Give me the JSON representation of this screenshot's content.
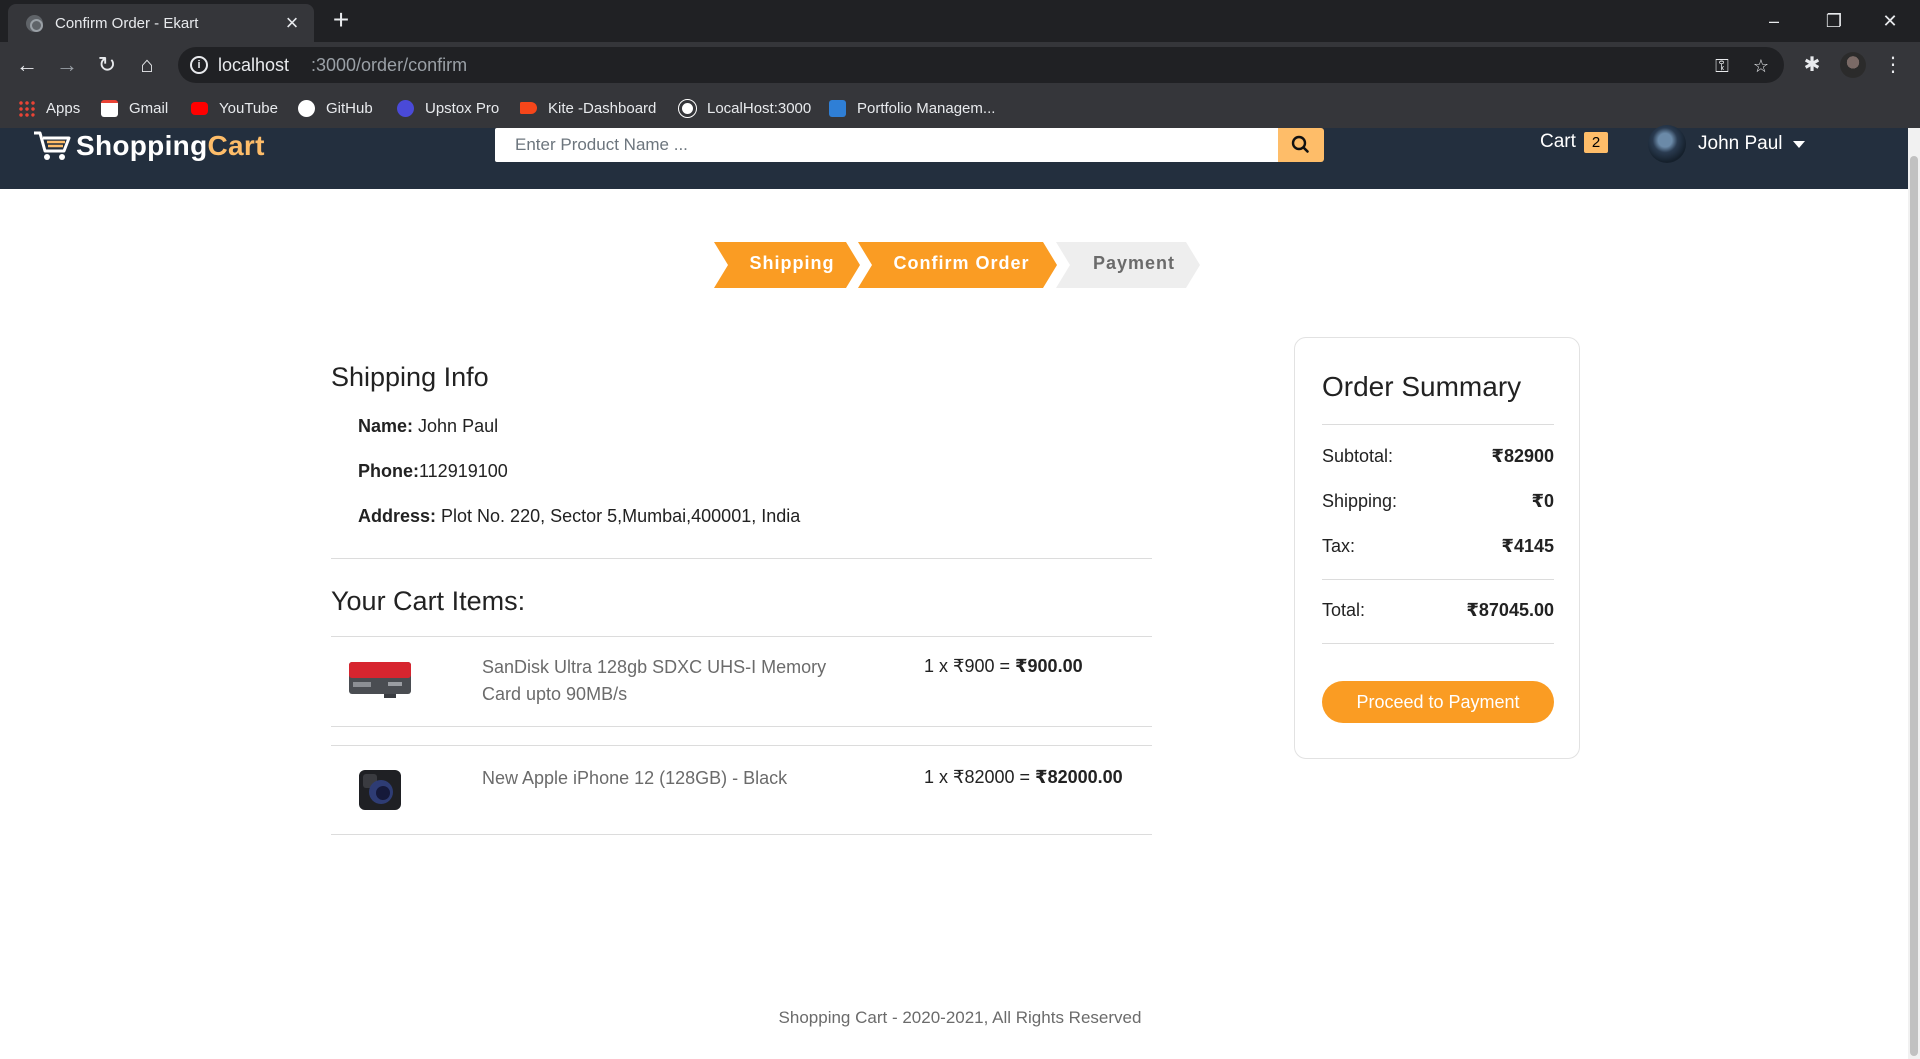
{
  "browser": {
    "tab_title": "Confirm Order - Ekart",
    "url_host": "localhost",
    "url_path": ":3000/order/confirm",
    "bookmarks": [
      {
        "label": "Apps",
        "icon": "apps-grid-icon"
      },
      {
        "label": "Gmail",
        "icon": "gmail-icon"
      },
      {
        "label": "YouTube",
        "icon": "youtube-icon"
      },
      {
        "label": "GitHub",
        "icon": "github-icon"
      },
      {
        "label": "Upstox Pro",
        "icon": "upstox-icon"
      },
      {
        "label": "Kite -Dashboard",
        "icon": "kite-icon"
      },
      {
        "label": "LocalHost:3000",
        "icon": "globe-icon"
      },
      {
        "label": "Portfolio Managem...",
        "icon": "portfolio-icon"
      }
    ]
  },
  "header": {
    "logo_main": "Shopping",
    "logo_accent": "Cart",
    "search_placeholder": "Enter Product Name ...",
    "cart_label": "Cart",
    "cart_count": "2",
    "user_name": "John Paul"
  },
  "steps": [
    {
      "label": "Shipping",
      "state": "complete"
    },
    {
      "label": "Confirm Order",
      "state": "active"
    },
    {
      "label": "Payment",
      "state": "pending"
    }
  ],
  "shipping_info": {
    "title": "Shipping Info",
    "name_label": "Name:",
    "name_value": " John Paul",
    "phone_label": "Phone:",
    "phone_value": "112919100",
    "address_label": "Address:",
    "address_value": " Plot No. 220, Sector 5,Mumbai,400001, India"
  },
  "cart": {
    "title": "Your Cart Items:",
    "items": [
      {
        "name": "SanDisk Ultra 128gb SDXC UHS-I Memory Card upto 90MB/s",
        "qty_price": "1 x ₹900 = ",
        "total": "₹900.00",
        "image": "memory-card-image"
      },
      {
        "name": "New Apple iPhone 12 (128GB) - Black",
        "qty_price": "1 x ₹82000 = ",
        "total": "₹82000.00",
        "image": "iphone-image"
      }
    ]
  },
  "summary": {
    "title": "Order Summary",
    "subtotal_label": "Subtotal:",
    "subtotal_value": "₹82900",
    "shipping_label": "Shipping:",
    "shipping_value": "₹0",
    "tax_label": "Tax:",
    "tax_value": "₹4145",
    "total_label": "Total:",
    "total_value": "₹87045.00",
    "button_label": "Proceed to Payment"
  },
  "footer": {
    "text": "Shopping Cart - 2020-2021, All Rights Reserved"
  },
  "colors": {
    "header_bg": "#232f3e",
    "accent": "#febd69",
    "step_active": "#fa9c23",
    "step_pending": "#eeeeee",
    "pay_button": "#fa9c23"
  }
}
